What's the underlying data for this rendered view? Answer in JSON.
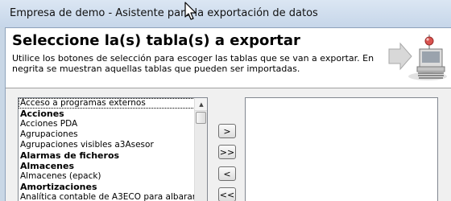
{
  "window": {
    "title": "Empresa de demo - Asistente para la exportación de datos"
  },
  "header": {
    "title": "Seleccione la(s) tabla(s) a exportar",
    "description": "Utilice los botones de selección para escoger las tablas que se van a exportar. En negrita se muestran aquellas tablas que pueden ser importadas."
  },
  "source_list": {
    "items": [
      {
        "label": "Acceso a programas externos",
        "bold": false,
        "focused": true
      },
      {
        "label": "Acciones",
        "bold": true,
        "focused": false
      },
      {
        "label": "Acciones PDA",
        "bold": false,
        "focused": false
      },
      {
        "label": "Agrupaciones",
        "bold": false,
        "focused": false
      },
      {
        "label": "Agrupaciones visibles a3Asesor",
        "bold": false,
        "focused": false
      },
      {
        "label": "Alarmas de ficheros",
        "bold": true,
        "focused": false
      },
      {
        "label": "Almacenes",
        "bold": true,
        "focused": false
      },
      {
        "label": "Almacenes (epack)",
        "bold": false,
        "focused": false
      },
      {
        "label": "Amortizaciones",
        "bold": true,
        "focused": false
      },
      {
        "label": "Analítica contable de A3ECO para albaranes",
        "bold": false,
        "focused": false
      }
    ]
  },
  "target_list": {
    "items": []
  },
  "buttons": {
    "add_one": ">",
    "add_all": ">>",
    "remove_one": "<",
    "remove_all": "<<"
  },
  "icons": {
    "wizard": "export-wizard-icon",
    "cursor": "mouse-pointer-icon",
    "scroll_up": "scroll-up-arrow-icon"
  }
}
